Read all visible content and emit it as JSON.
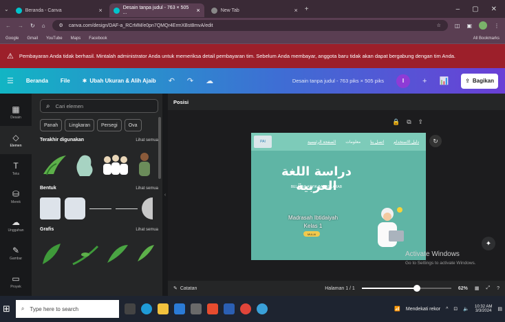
{
  "browser": {
    "tabs": [
      {
        "title": "Beranda - Canva",
        "active": false
      },
      {
        "title": "Desain tanpa judul - 763 × 505 ...",
        "active": true
      },
      {
        "title": "New Tab",
        "active": false
      }
    ],
    "url": "canva.com/design/DAF-a_RCrMM/e0pn7QMQr4ErmXBst8mvA/edit",
    "bookmarks": [
      "Google",
      "Gmail",
      "YouTube",
      "Maps",
      "Facebook"
    ],
    "all_bookmarks": "All Bookmarks"
  },
  "warning": "Pembayaran Anda tidak berhasil. Mintalah administrator Anda untuk memeriksa detail pembayaran tim. Sebelum Anda membayar, anggota baru tidak akan dapat bergabung dengan tim Anda.",
  "toolbar": {
    "home": "Beranda",
    "file": "File",
    "resize": "Ubah Ukuran & Alih Ajaib",
    "doc_title": "Desain tanpa judul - 763 piks × 505 piks",
    "avatar": "I",
    "share": "Bagikan"
  },
  "rail": [
    {
      "label": "Desain",
      "icon": "template-icon"
    },
    {
      "label": "Elemen",
      "icon": "elements-icon"
    },
    {
      "label": "Teks",
      "icon": "text-icon"
    },
    {
      "label": "Merek",
      "icon": "brand-icon"
    },
    {
      "label": "Unggahan",
      "icon": "upload-icon"
    },
    {
      "label": "Gambar",
      "icon": "draw-icon"
    },
    {
      "label": "Proyek",
      "icon": "folder-icon"
    }
  ],
  "panel": {
    "search_placeholder": "Cari elemen",
    "chips": [
      "Panah",
      "Lingkaran",
      "Persegi",
      "Ova"
    ],
    "sections": [
      {
        "title": "Terakhir digunakan",
        "more": "Lihat semua"
      },
      {
        "title": "Bentuk",
        "more": "Lihat semua"
      },
      {
        "title": "Grafis",
        "more": "Lihat semua"
      }
    ]
  },
  "canvas": {
    "position_label": "Posisi",
    "slide": {
      "logo": "PAI",
      "nav": [
        "الصفحة الرئيسية",
        "معلومات",
        "اتصل بنا",
        "دليل الاستخدام"
      ],
      "title": "دراسة اللغة العربية",
      "subtitle": "BELAJAR ASYIK BAHASA ARAB",
      "line1": "Madrasah Ibtidaiyah",
      "line2": "Kelas 1",
      "start": "MULAI"
    },
    "activate_title": "Activate Windows",
    "activate_sub": "Go to Settings to activate Windows.",
    "notes": "Catatan",
    "page": "Halaman 1 / 1",
    "zoom": "62%",
    "zoom_fraction": 0.62
  },
  "taskbar": {
    "search_placeholder": "Type here to search",
    "weather": "Mendekati rekor",
    "time": "10:32 AM",
    "date": "3/3/2024"
  }
}
